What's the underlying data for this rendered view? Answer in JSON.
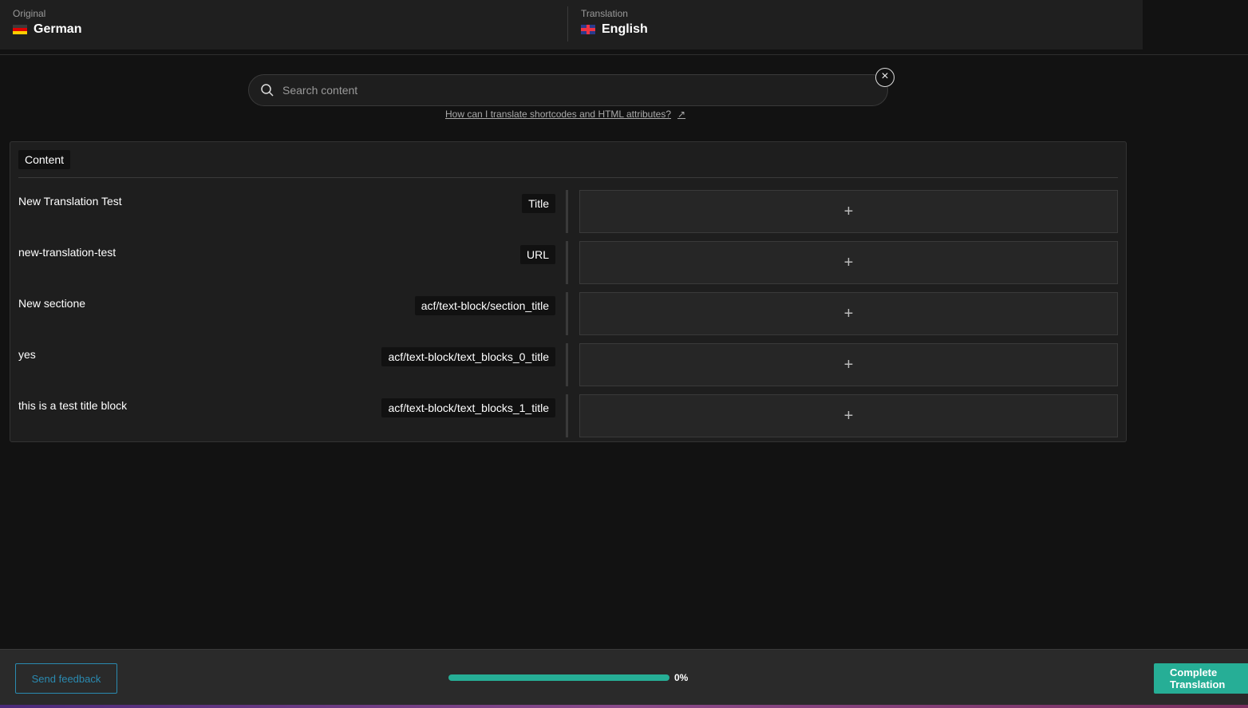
{
  "header": {
    "original_label": "Original",
    "original_lang": "German",
    "translation_label": "Translation",
    "translation_lang": "English"
  },
  "search": {
    "placeholder": "Search content",
    "help_link": "How can I translate shortcodes and HTML attributes?"
  },
  "panel": {
    "tab": "Content",
    "rows": [
      {
        "text": "New Translation Test",
        "badge": "Title"
      },
      {
        "text": "new-translation-test",
        "badge": "URL"
      },
      {
        "text": "New sectione",
        "badge": "acf/text-block/section_title"
      },
      {
        "text": "yes",
        "badge": "acf/text-block/text_blocks_0_title"
      },
      {
        "text": "this is a test title block",
        "badge": "acf/text-block/text_blocks_1_title"
      }
    ],
    "add_symbol": "+"
  },
  "footer": {
    "feedback": "Send feedback",
    "progress_percent": 0,
    "progress_label": "0%",
    "complete": "Complete Translation"
  },
  "colors": {
    "accent": "#26ae96",
    "feedback": "#2a8ab0"
  }
}
